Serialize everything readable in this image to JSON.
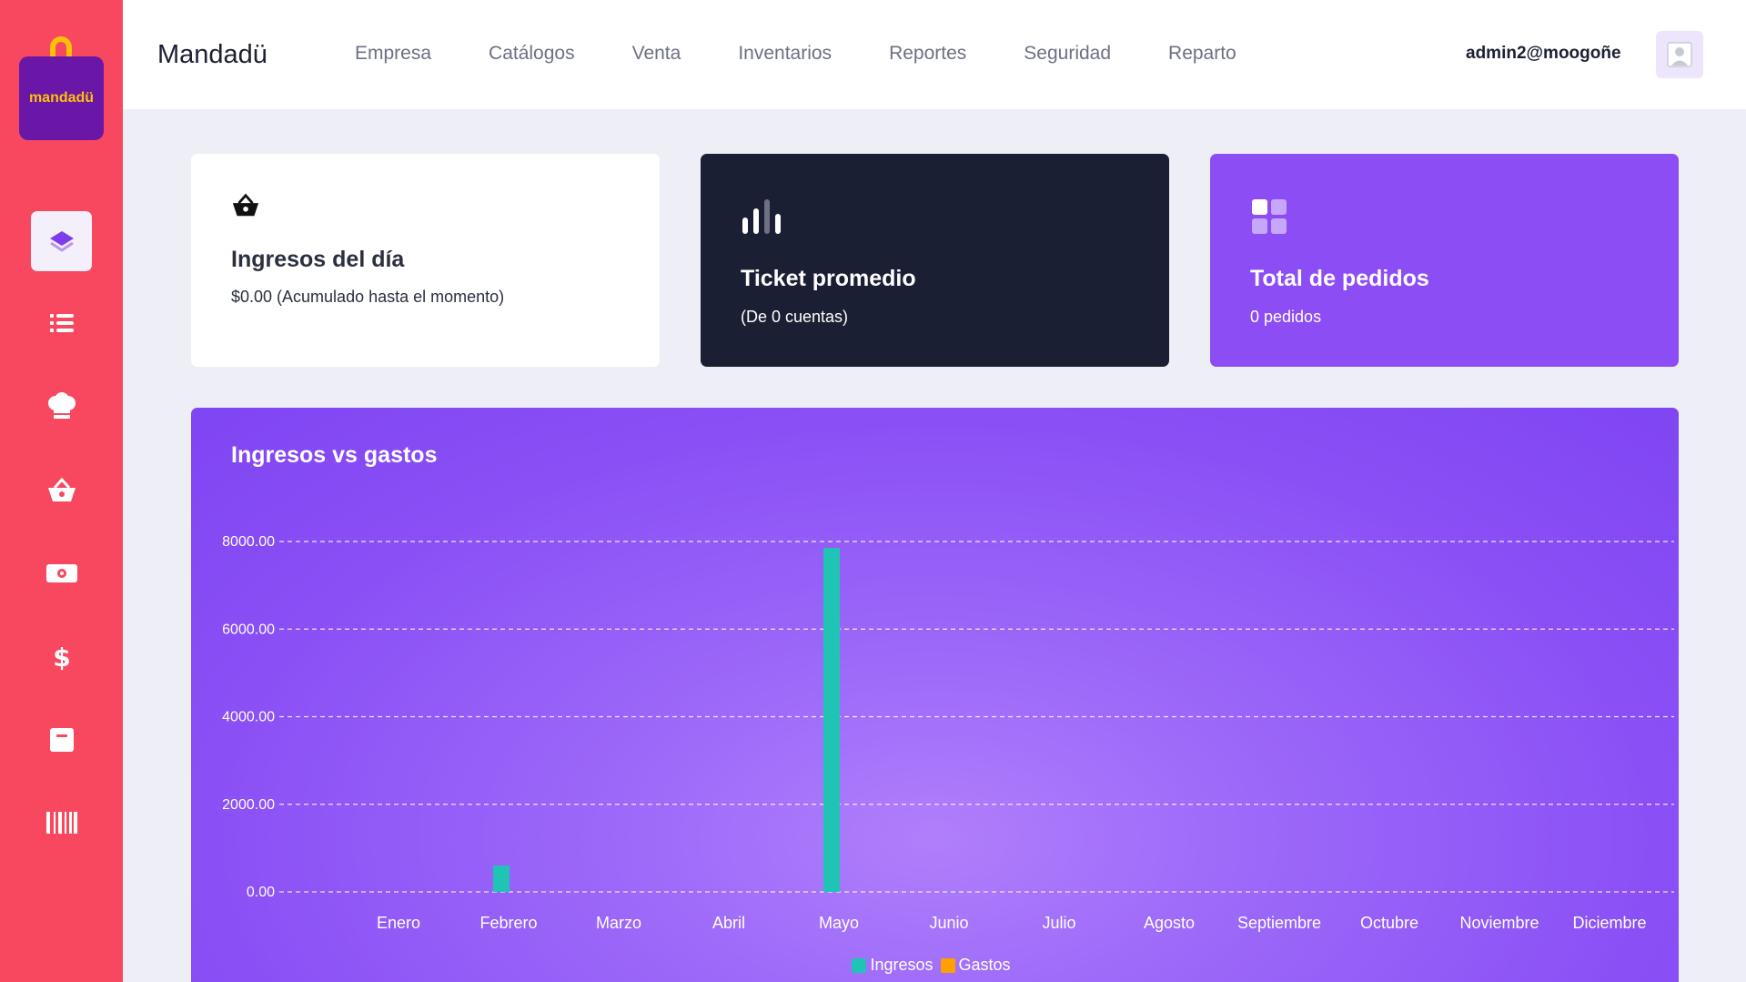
{
  "app": {
    "logo_text": "mandadü",
    "brand": "Mandadü",
    "user": "admin2@moogoñe"
  },
  "nav": [
    {
      "label": "Empresa"
    },
    {
      "label": "Catálogos"
    },
    {
      "label": "Venta"
    },
    {
      "label": "Inventarios"
    },
    {
      "label": "Reportes"
    },
    {
      "label": "Seguridad"
    },
    {
      "label": "Reparto"
    }
  ],
  "sidebar": {
    "items": [
      {
        "icon": "layers-icon",
        "active": true
      },
      {
        "icon": "list-icon"
      },
      {
        "icon": "chef-hat-icon"
      },
      {
        "icon": "basket-icon"
      },
      {
        "icon": "cash-icon"
      },
      {
        "icon": "dollar-icon"
      },
      {
        "icon": "box-icon"
      },
      {
        "icon": "barcode-icon"
      }
    ]
  },
  "cards": {
    "income": {
      "icon": "basket-icon",
      "title": "Ingresos del día",
      "subtitle": "$0.00 (Acumulado hasta el momento)"
    },
    "ticket": {
      "icon": "bar-chart-icon",
      "title": "Ticket promedio",
      "subtitle": "(De 0 cuentas)"
    },
    "orders": {
      "icon": "grid-icon",
      "title": "Total de pedidos",
      "subtitle": "0 pedidos"
    }
  },
  "colors": {
    "sidebar": "#f7485f",
    "accent": "#8c4df5",
    "dark_card": "#1b1f33",
    "ingresos": "#1fc4b4",
    "gastos": "#ffa000"
  },
  "chart_data": {
    "type": "bar",
    "title": "Ingresos vs gastos",
    "categories": [
      "Enero",
      "Febrero",
      "Marzo",
      "Abril",
      "Mayo",
      "Junio",
      "Julio",
      "Agosto",
      "Septiembre",
      "Octubre",
      "Noviembre",
      "Diciembre"
    ],
    "series": [
      {
        "name": "Ingresos",
        "color": "#1fc4b4",
        "values": [
          0,
          600,
          0,
          0,
          7850,
          0,
          0,
          0,
          0,
          0,
          0,
          0
        ]
      },
      {
        "name": "Gastos",
        "color": "#ffa000",
        "values": [
          0,
          0,
          0,
          0,
          0,
          0,
          0,
          0,
          0,
          0,
          0,
          0
        ]
      }
    ],
    "yticks": [
      "0.00",
      "2000.00",
      "4000.00",
      "6000.00",
      "8000.00"
    ],
    "ylim": [
      0,
      8000
    ],
    "grid": true,
    "legend": "bottom-center"
  }
}
